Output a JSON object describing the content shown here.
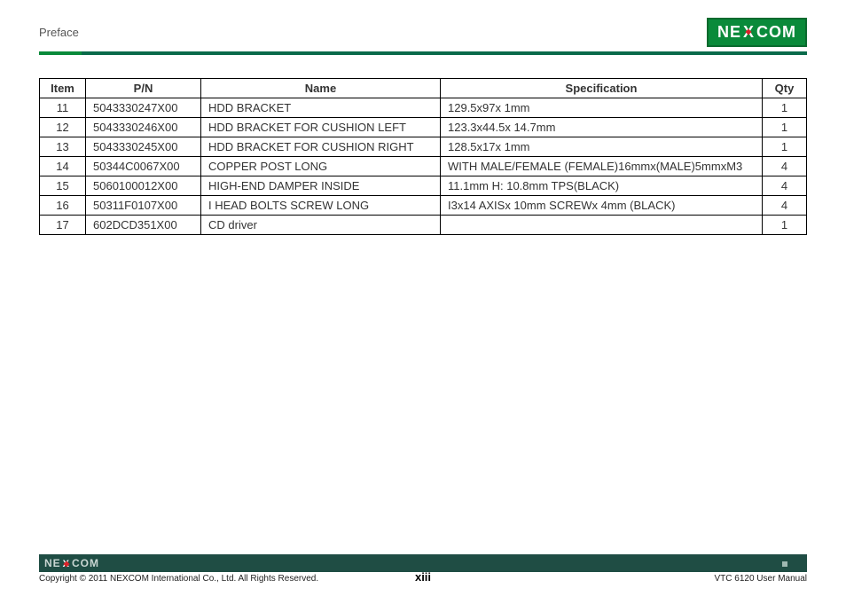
{
  "header": {
    "title": "Preface",
    "logo_text_left": "NE",
    "logo_text_right": "COM"
  },
  "chart_data": {
    "type": "table",
    "headers": [
      "Item",
      "P/N",
      "Name",
      "Specification",
      "Qty"
    ],
    "rows": [
      {
        "item": "11",
        "pn": "5043330247X00",
        "name": "HDD BRACKET",
        "spec": "129.5x97x 1mm",
        "qty": "1"
      },
      {
        "item": "12",
        "pn": "5043330246X00",
        "name": "HDD BRACKET FOR CUSHION LEFT",
        "spec": "123.3x44.5x 14.7mm",
        "qty": "1"
      },
      {
        "item": "13",
        "pn": "5043330245X00",
        "name": "HDD BRACKET FOR CUSHION RIGHT",
        "spec": "128.5x17x 1mm",
        "qty": "1"
      },
      {
        "item": "14",
        "pn": "50344C0067X00",
        "name": "COPPER POST LONG",
        "spec": "WITH MALE/FEMALE (FEMALE)16mmx(MALE)5mmxM3",
        "qty": "4"
      },
      {
        "item": "15",
        "pn": "5060100012X00",
        "name": "HIGH-END DAMPER INSIDE",
        "spec": "11.1mm H: 10.8mm TPS(BLACK)",
        "qty": "4"
      },
      {
        "item": "16",
        "pn": "50311F0107X00",
        "name": "I HEAD BOLTS SCREW LONG",
        "spec": "I3x14 AXISx 10mm SCREWx 4mm (BLACK)",
        "qty": "4"
      },
      {
        "item": "17",
        "pn": "602DCD351X00",
        "name": "CD driver",
        "spec": "",
        "qty": "1"
      }
    ]
  },
  "footer": {
    "logo_text_left": "NE",
    "logo_text_right": "COM",
    "copyright": "Copyright © 2011 NEXCOM International Co., Ltd. All Rights Reserved.",
    "page_number": "xiii",
    "doc_title": "VTC 6120 User Manual"
  }
}
